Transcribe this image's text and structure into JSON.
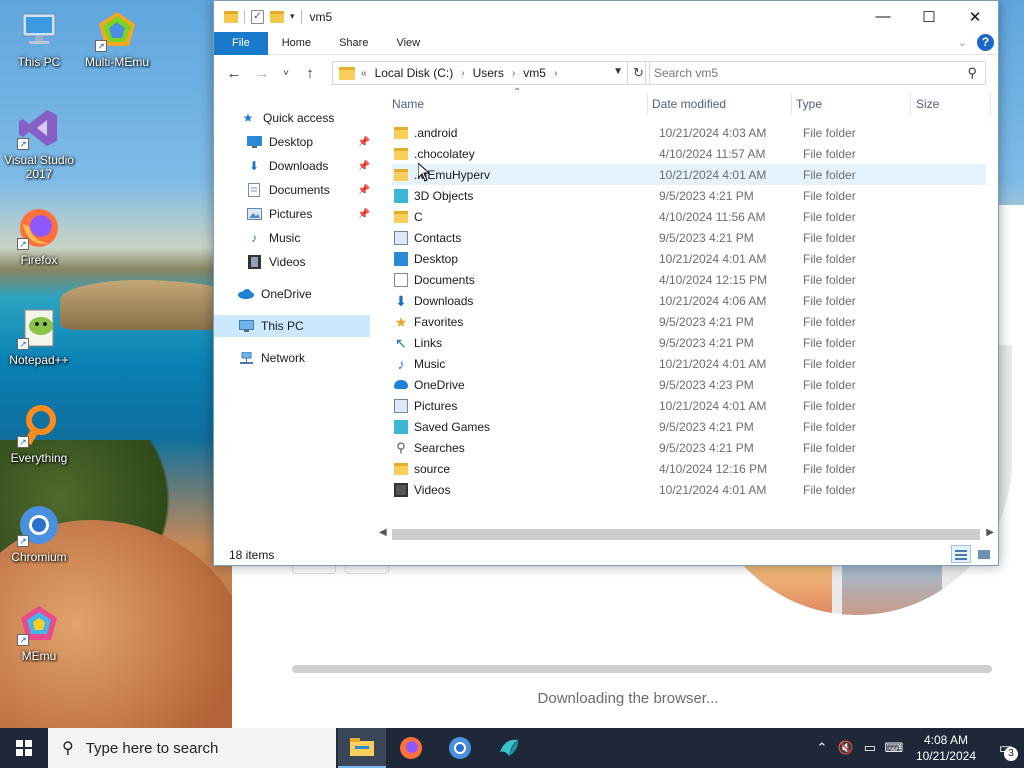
{
  "desktop": {
    "icons": [
      {
        "label": "This PC"
      },
      {
        "label": "Multi-MEmu"
      },
      {
        "label": "Visual Studio 2017"
      },
      {
        "label": "Firefox"
      },
      {
        "label": "Notepad++"
      },
      {
        "label": "Everything"
      },
      {
        "label": "Chromium"
      },
      {
        "label": "MEmu"
      }
    ]
  },
  "background_page": {
    "status_text": "Downloading the browser...",
    "download_progress": 1.0
  },
  "explorer": {
    "title": "vm5",
    "window_controls": {
      "minimize": "—",
      "maximize": "☐",
      "close": "✕"
    },
    "ribbon_tabs": [
      "File",
      "Home",
      "Share",
      "View"
    ],
    "help_label": "?",
    "nav_buttons": {
      "back": "←",
      "forward": "→",
      "recent": "˅",
      "up": "↑"
    },
    "address": {
      "overflow": "«",
      "crumbs": [
        "Local Disk (C:)",
        "Users",
        "vm5"
      ],
      "separator": "›"
    },
    "search": {
      "placeholder": "Search vm5"
    },
    "nav_pane": {
      "quick_access": "Quick access",
      "quick_items": [
        "Desktop",
        "Downloads",
        "Documents",
        "Pictures",
        "Music",
        "Videos"
      ],
      "onedrive": "OneDrive",
      "this_pc": "This PC",
      "network": "Network"
    },
    "columns": {
      "name": "Name",
      "date": "Date modified",
      "type": "Type",
      "size": "Size"
    },
    "files": [
      {
        "name": ".android",
        "date": "10/21/2024 4:03 AM",
        "type": "File folder",
        "icon": "folder-icon"
      },
      {
        "name": ".chocolatey",
        "date": "4/10/2024 11:57 AM",
        "type": "File folder",
        "icon": "folder-icon"
      },
      {
        "name": ".MEmuHyperv",
        "date": "10/21/2024 4:01 AM",
        "type": "File folder",
        "icon": "folder-icon"
      },
      {
        "name": "3D Objects",
        "date": "9/5/2023 4:21 PM",
        "type": "File folder",
        "icon": "cube-icon"
      },
      {
        "name": "C",
        "date": "4/10/2024 11:56 AM",
        "type": "File folder",
        "icon": "folder-icon"
      },
      {
        "name": "Contacts",
        "date": "9/5/2023 4:21 PM",
        "type": "File folder",
        "icon": "contacts-icon"
      },
      {
        "name": "Desktop",
        "date": "10/21/2024 4:01 AM",
        "type": "File folder",
        "icon": "desktop-icon"
      },
      {
        "name": "Documents",
        "date": "4/10/2024 12:15 PM",
        "type": "File folder",
        "icon": "documents-icon"
      },
      {
        "name": "Downloads",
        "date": "10/21/2024 4:06 AM",
        "type": "File folder",
        "icon": "download-icon"
      },
      {
        "name": "Favorites",
        "date": "9/5/2023 4:21 PM",
        "type": "File folder",
        "icon": "star-icon"
      },
      {
        "name": "Links",
        "date": "9/5/2023 4:21 PM",
        "type": "File folder",
        "icon": "link-icon"
      },
      {
        "name": "Music",
        "date": "10/21/2024 4:01 AM",
        "type": "File folder",
        "icon": "music-icon"
      },
      {
        "name": "OneDrive",
        "date": "9/5/2023 4:23 PM",
        "type": "File folder",
        "icon": "cloud-icon"
      },
      {
        "name": "Pictures",
        "date": "10/21/2024 4:01 AM",
        "type": "File folder",
        "icon": "pictures-icon"
      },
      {
        "name": "Saved Games",
        "date": "9/5/2023 4:21 PM",
        "type": "File folder",
        "icon": "games-icon"
      },
      {
        "name": "Searches",
        "date": "9/5/2023 4:21 PM",
        "type": "File folder",
        "icon": "search-icon"
      },
      {
        "name": "source",
        "date": "4/10/2024 12:16 PM",
        "type": "File folder",
        "icon": "folder-icon"
      },
      {
        "name": "Videos",
        "date": "10/21/2024 4:01 AM",
        "type": "File folder",
        "icon": "videos-icon"
      }
    ],
    "status": {
      "item_count": "18 items"
    }
  },
  "taskbar": {
    "search_placeholder": "Type here to search",
    "apps": [
      "File Explorer",
      "Firefox",
      "Chromium",
      "MEmu"
    ],
    "clock": {
      "time": "4:08 AM",
      "date": "10/21/2024"
    },
    "notification_count": "3"
  },
  "colors": {
    "accent": "#1979ca",
    "selected": "#cce8ff",
    "hover": "#e5f3ff",
    "taskbar": "#1f2838"
  }
}
